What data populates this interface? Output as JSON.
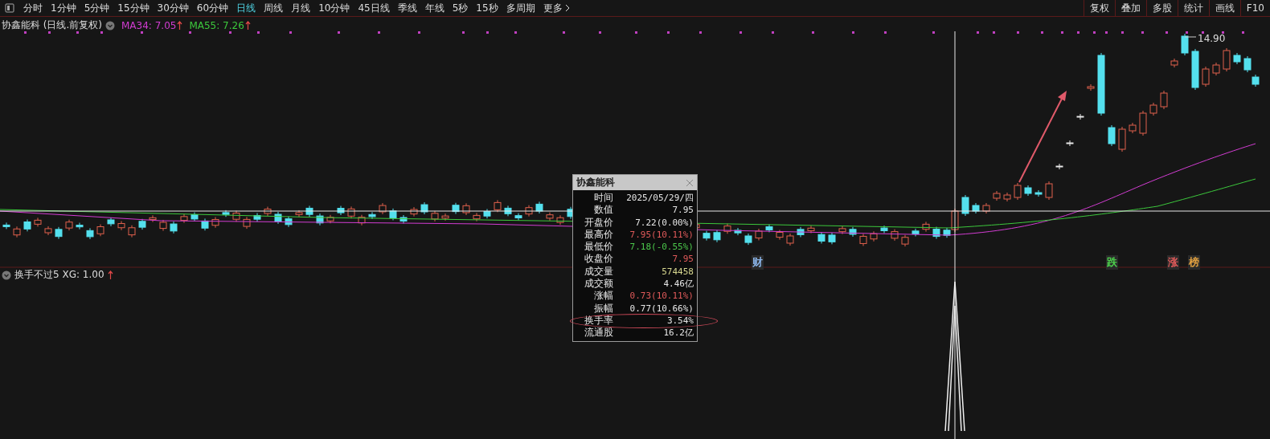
{
  "toolbar": {
    "periods": [
      {
        "label": "分时",
        "selected": false
      },
      {
        "label": "1分钟",
        "selected": false
      },
      {
        "label": "5分钟",
        "selected": false
      },
      {
        "label": "15分钟",
        "selected": false
      },
      {
        "label": "30分钟",
        "selected": false
      },
      {
        "label": "60分钟",
        "selected": false
      },
      {
        "label": "日线",
        "selected": true
      },
      {
        "label": "周线",
        "selected": false
      },
      {
        "label": "月线",
        "selected": false
      },
      {
        "label": "10分钟",
        "selected": false
      },
      {
        "label": "45日线",
        "selected": false
      },
      {
        "label": "季线",
        "selected": false
      },
      {
        "label": "年线",
        "selected": false
      },
      {
        "label": "5秒",
        "selected": false
      },
      {
        "label": "15秒",
        "selected": false
      },
      {
        "label": "多周期",
        "selected": false
      }
    ],
    "more": "更多",
    "tools": [
      "复权",
      "叠加",
      "多股",
      "统计",
      "画线",
      "F10"
    ]
  },
  "legend": {
    "title": "协鑫能科 (日线.前复权)",
    "ma": [
      {
        "text": "MA34: 7.05",
        "color": "#d23cd2"
      },
      {
        "text": "MA55: 7.26",
        "color": "#3cc83c"
      }
    ]
  },
  "chart": {
    "high_label": "14.90",
    "events": [
      {
        "label": "财",
        "color": "#8ab4e8"
      },
      {
        "label": "跌",
        "color": "#4cd04c"
      },
      {
        "label": "涨",
        "color": "#e05a5a"
      },
      {
        "label": "榜",
        "color": "#e0a040"
      }
    ]
  },
  "popup": {
    "title": "协鑫能科",
    "rows": [
      {
        "label": "时间",
        "value": "2025/05/29/四",
        "color": "#e6e6e6"
      },
      {
        "label": "数值",
        "value": "7.95",
        "color": "#e6e6e6"
      },
      {
        "label": "开盘价",
        "value": "7.22(0.00%)",
        "color": "#e6e6e6"
      },
      {
        "label": "最高价",
        "value": "7.95(10.11%)",
        "color": "#e05a5a"
      },
      {
        "label": "最低价",
        "value": "7.18(-0.55%)",
        "color": "#4cc84c"
      },
      {
        "label": "收盘价",
        "value": "7.95",
        "color": "#e05a5a"
      },
      {
        "label": "成交量",
        "value": "574458",
        "color": "#d8d890"
      },
      {
        "label": "成交额",
        "value": "4.46亿",
        "color": "#e6e6e6"
      },
      {
        "label": "涨幅",
        "value": "0.73(10.11%)",
        "color": "#e05a5a"
      },
      {
        "label": "振幅",
        "value": "0.77(10.66%)",
        "color": "#e6e6e6"
      },
      {
        "label": "换手率",
        "value": "3.54%",
        "color": "#e6e6e6",
        "highlighted": true
      },
      {
        "label": "流通股",
        "value": "16.2亿",
        "color": "#e6e6e6"
      }
    ]
  },
  "indicator": {
    "label": "换手不过5 XG: 1.00"
  }
}
